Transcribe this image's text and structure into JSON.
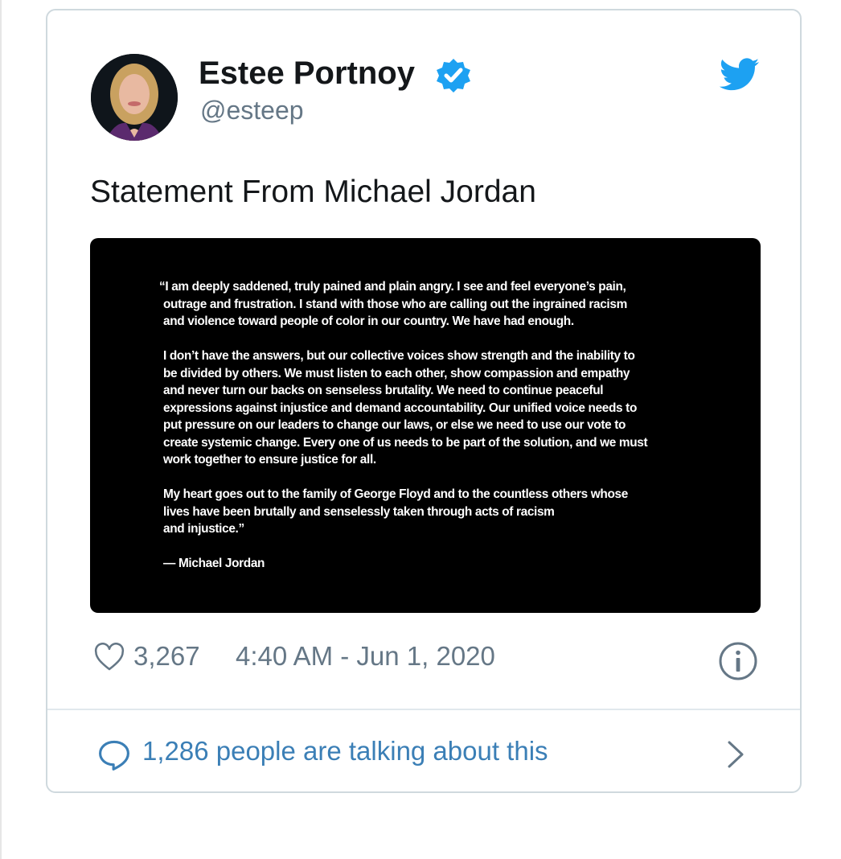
{
  "tweet": {
    "author": {
      "name": "Estee Portnoy",
      "handle": "@esteep",
      "verified": true
    },
    "text": "Statement From Michael Jordan",
    "media_statement": {
      "lines_p1": [
        "“I am deeply saddened, truly pained and plain angry. I see and feel everyone’s pain,",
        "outrage and frustration. I stand with those who are calling out the ingrained racism",
        "and violence toward people of color in our country. We have had enough."
      ],
      "lines_p2": [
        "I don’t have the answers, but our collective voices show strength and the inability to",
        "be divided by others. We must listen to each other, show compassion and empathy",
        "and never turn our backs on senseless brutality. We need to continue peaceful",
        "expressions against injustice and demand accountability. Our unified voice needs to",
        "put pressure on our leaders to change our laws, or else we need to use our vote to",
        "create systemic change. Every one of us needs to be part of the solution, and we must",
        "work together to ensure justice for all."
      ],
      "lines_p3": [
        "My heart goes out to the family of George Floyd and to the countless others whose",
        "lives have been brutally and senselessly taken through acts of racism",
        "and injustice.”"
      ],
      "signature": "— Michael Jordan"
    },
    "likes": "3,267",
    "timestamp": "4:40 AM - Jun 1, 2020",
    "talking": "1,286 people are talking about this"
  },
  "colors": {
    "verified_blue": "#1da1f2",
    "twitter_blue": "#1da1f2",
    "link_blue": "#3b7fb6",
    "muted_gray": "#657786",
    "border": "#cfd9de"
  },
  "icons": [
    "verified-icon",
    "twitter-bird-icon",
    "heart-icon",
    "info-icon",
    "comment-icon",
    "chevron-right-icon"
  ]
}
